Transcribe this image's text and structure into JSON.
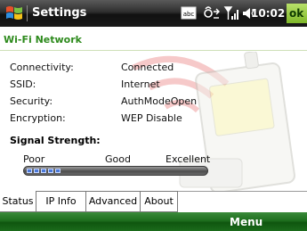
{
  "titlebar": {
    "title": "Settings",
    "clock": "10:02",
    "ok_label": "ok",
    "status_icons": [
      "keyboard-abc-icon",
      "connectivity-icon",
      "signal-strength-icon",
      "speaker-icon"
    ]
  },
  "header": {
    "title": "Wi-Fi Network"
  },
  "info": [
    {
      "label": "Connectivity:",
      "value": "Connected"
    },
    {
      "label": "SSID:",
      "value": "Internet"
    },
    {
      "label": "Security:",
      "value": "AuthModeOpen"
    },
    {
      "label": "Encryption:",
      "value": "WEP Disable"
    }
  ],
  "signal": {
    "title": "Signal Strength:",
    "scale": [
      "Poor",
      "Good",
      "Excellent"
    ],
    "level": 0.2
  },
  "tabs": [
    {
      "label": "Status",
      "active": true
    },
    {
      "label": "IP Info",
      "active": false
    },
    {
      "label": "Advanced",
      "active": false
    },
    {
      "label": "About",
      "active": false
    }
  ],
  "menubar": {
    "right_softkey": "Menu"
  },
  "colors": {
    "accent_green": "#2d8a1c",
    "signal_blue": "#4a78d8"
  }
}
